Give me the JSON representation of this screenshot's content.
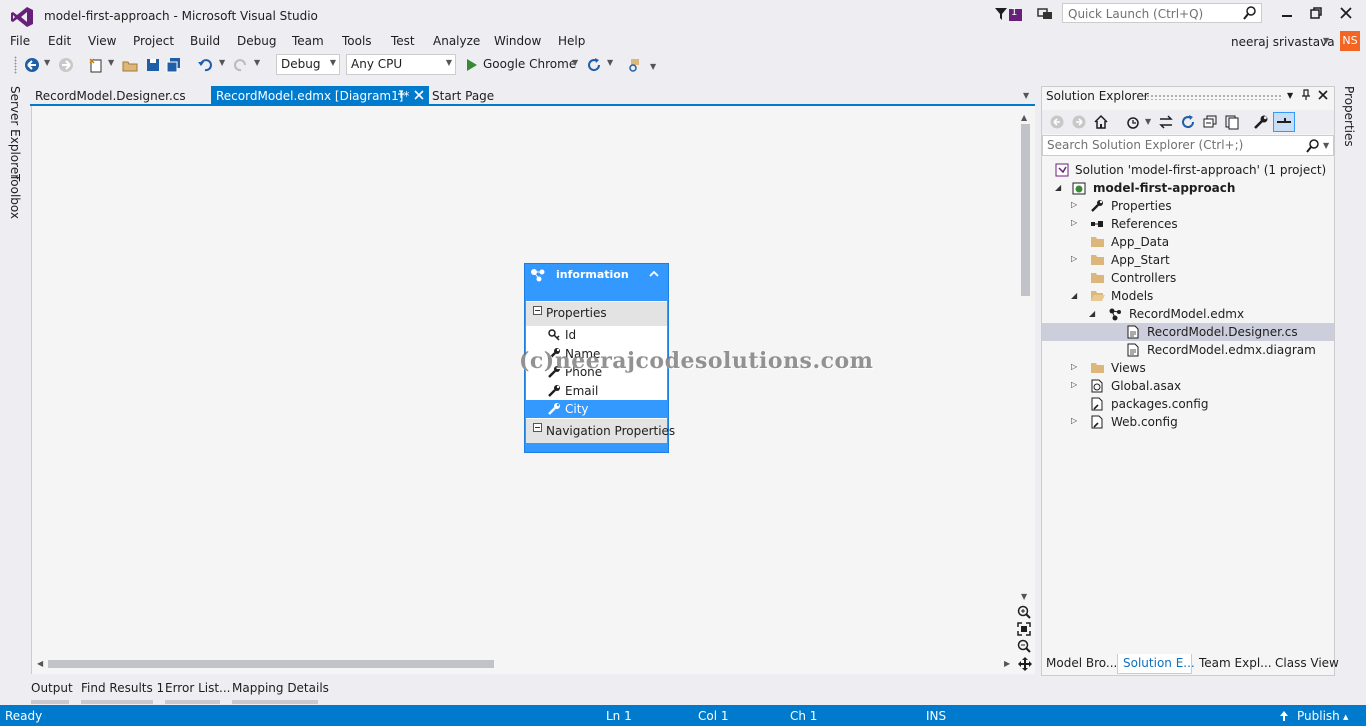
{
  "window": {
    "title": "model-first-approach - Microsoft Visual Studio",
    "notification_count": "1",
    "quick_launch_placeholder": "Quick Launch (Ctrl+Q)"
  },
  "menu": [
    "File",
    "Edit",
    "View",
    "Project",
    "Build",
    "Debug",
    "Team",
    "Tools",
    "Test",
    "Analyze",
    "Window",
    "Help"
  ],
  "user": {
    "name": "neeraj srivastava",
    "initials": "NS"
  },
  "toolbar": {
    "config": "Debug",
    "platform": "Any CPU",
    "start_target": "Google Chrome"
  },
  "left_tabs": [
    "Server Explorer",
    "Toolbox"
  ],
  "doc_tabs": [
    {
      "label": "RecordModel.Designer.cs",
      "active": false
    },
    {
      "label": "RecordModel.edmx [Diagram1]*",
      "active": true
    },
    {
      "label": "Start Page",
      "active": false
    }
  ],
  "entity": {
    "name": "information",
    "properties_header": "Properties",
    "properties": [
      "Id",
      "Name",
      "Phone",
      "Email",
      "City"
    ],
    "selected_property": "City",
    "navigation_header": "Navigation Properties"
  },
  "watermark": "(c)neerajcodesolutions.com",
  "bottom_tabs": [
    "Output",
    "Find Results 1",
    "Error List...",
    "Mapping Details"
  ],
  "status": {
    "ready": "Ready",
    "line": "Ln 1",
    "col": "Col 1",
    "ch": "Ch 1",
    "mode": "INS",
    "publish": "Publish"
  },
  "solution_explorer": {
    "title": "Solution Explorer",
    "search_placeholder": "Search Solution Explorer (Ctrl+;)",
    "tree": [
      {
        "label": "Solution 'model-first-approach' (1 project)",
        "icon": "solution-icon",
        "indent": 0,
        "expander": ""
      },
      {
        "label": "model-first-approach",
        "icon": "web-project-icon",
        "indent": 0,
        "expander": "expanded",
        "bold": true
      },
      {
        "label": "Properties",
        "icon": "wrench-icon",
        "indent": 1,
        "expander": "collapsed"
      },
      {
        "label": "References",
        "icon": "references-icon",
        "indent": 1,
        "expander": "collapsed"
      },
      {
        "label": "App_Data",
        "icon": "folder-icon",
        "indent": 1,
        "expander": ""
      },
      {
        "label": "App_Start",
        "icon": "folder-icon",
        "indent": 1,
        "expander": "collapsed"
      },
      {
        "label": "Controllers",
        "icon": "folder-icon",
        "indent": 1,
        "expander": ""
      },
      {
        "label": "Models",
        "icon": "folder-icon",
        "indent": 1,
        "expander": "expanded"
      },
      {
        "label": "RecordModel.edmx",
        "icon": "edmx-icon",
        "indent": 2,
        "expander": "expanded"
      },
      {
        "label": "RecordModel.Designer.cs",
        "icon": "cs-file-icon",
        "indent": 3,
        "expander": "",
        "selected": true
      },
      {
        "label": "RecordModel.edmx.diagram",
        "icon": "diagram-file-icon",
        "indent": 3,
        "expander": ""
      },
      {
        "label": "Views",
        "icon": "folder-icon",
        "indent": 1,
        "expander": "collapsed"
      },
      {
        "label": "Global.asax",
        "icon": "global-asax-icon",
        "indent": 1,
        "expander": "collapsed"
      },
      {
        "label": "packages.config",
        "icon": "config-file-icon",
        "indent": 1,
        "expander": ""
      },
      {
        "label": "Web.config",
        "icon": "config-file-icon",
        "indent": 1,
        "expander": "collapsed"
      }
    ],
    "bottom_tabs": [
      "Model Bro...",
      "Solution E...",
      "Team Expl...",
      "Class View"
    ],
    "active_bottom_tab": "Solution E..."
  },
  "right_tab": "Properties",
  "colors": {
    "accent": "#007acc",
    "entity_blue": "#3399ff",
    "selection": "#cccedb"
  }
}
